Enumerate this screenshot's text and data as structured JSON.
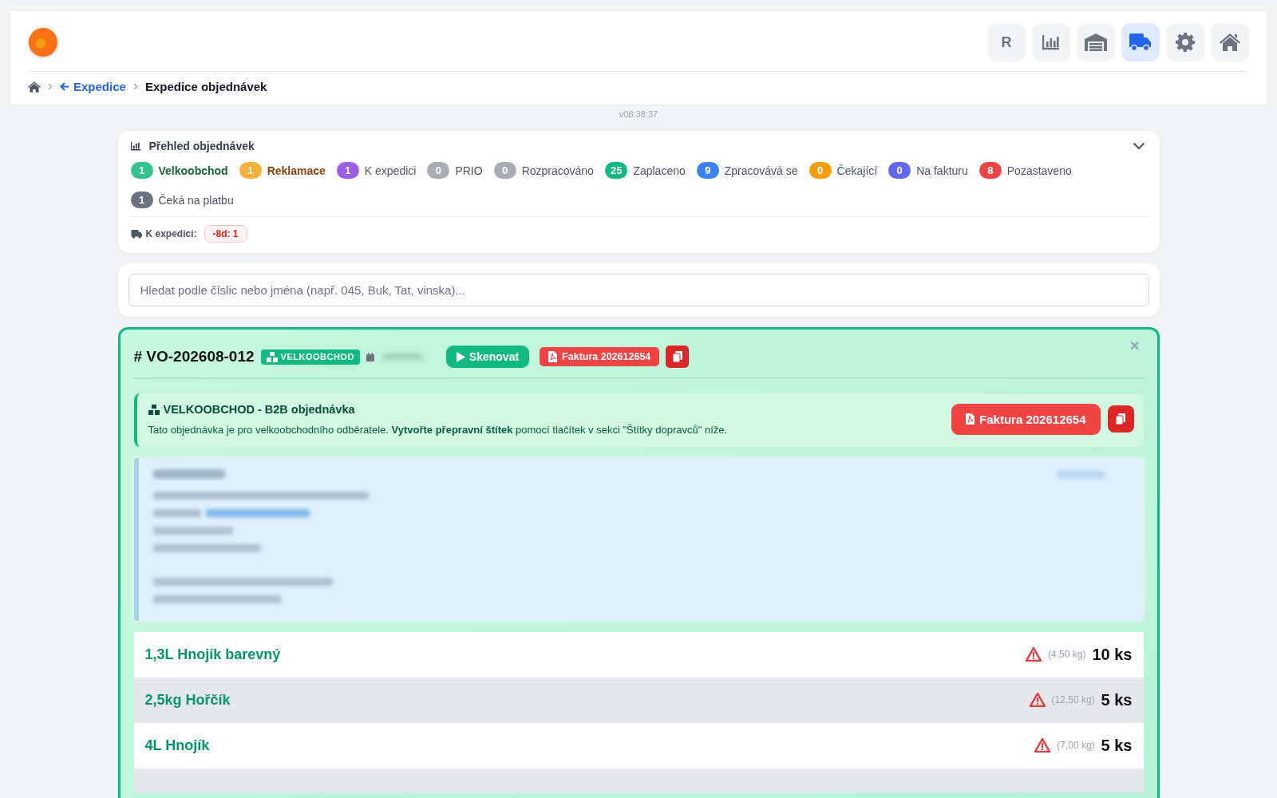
{
  "nav": [
    {
      "kind": "text",
      "label": "R",
      "selected": false
    },
    {
      "kind": "chart",
      "selected": false
    },
    {
      "kind": "warehouse",
      "selected": false
    },
    {
      "kind": "truck",
      "selected": true
    },
    {
      "kind": "gear",
      "selected": false
    },
    {
      "kind": "home",
      "selected": false
    }
  ],
  "breadcrumb": {
    "back": "Expedice",
    "current": "Expedice objednávek"
  },
  "version": "v08:38:37",
  "overview": {
    "title": "Přehled objednávek",
    "expanded": true,
    "statuses": [
      {
        "count": "1",
        "label": "Velkoobchod",
        "color": "#34c38f",
        "highlighted": true
      },
      {
        "count": "1",
        "label": "Reklamace",
        "color": "#f4b13a",
        "highlighted": true
      },
      {
        "count": "1",
        "label": "K expedici",
        "color": "#9b5de5",
        "highlighted": false
      },
      {
        "count": "0",
        "label": "PRIO",
        "color": "#a8adb5",
        "highlighted": false
      },
      {
        "count": "0",
        "label": "Rozpracováno",
        "color": "#a8adb5",
        "highlighted": false
      },
      {
        "count": "25",
        "label": "Zaplaceno",
        "color": "#10b981",
        "highlighted": false
      },
      {
        "count": "9",
        "label": "Zpracovává se",
        "color": "#3b82f6",
        "highlighted": false
      },
      {
        "count": "0",
        "label": "Čekající",
        "color": "#f59e0b",
        "highlighted": false
      },
      {
        "count": "0",
        "label": "Na fakturu",
        "color": "#6366f1",
        "highlighted": false
      },
      {
        "count": "8",
        "label": "Pozastaveno",
        "color": "#ef4444",
        "highlighted": false
      },
      {
        "count": "1",
        "label": "Čeká na platbu",
        "color": "#6b7280",
        "highlighted": false
      }
    ],
    "dispatch_label": "K expedici:",
    "dispatch_tag": "-8d: 1"
  },
  "search": {
    "placeholder": "Hledat podle číslic nebo jména (např. 045, Buk, Tat, vinska)..."
  },
  "order": {
    "number": "VO-202608-012",
    "hash": "#",
    "type_badge": "VELKOOBCHOD",
    "scan_button": "Skenovat",
    "invoice_button": "Faktura 202612654",
    "close": "×",
    "notice": {
      "title": "VELKOOBCHOD - B2B objednávka",
      "text": "Tato objednávka je pro velkoobchodního odběratele. **Vytvořte přepravní štítek** pomocí tlačítek v sekci \"Štítky dopravců\" níže.",
      "invoice_button": "Faktura 202612654"
    },
    "items": [
      {
        "name": "1,3L Hnojík barevný",
        "warning": true,
        "weight": "(4,50 kg)",
        "quantity": "10 ks"
      },
      {
        "name": "2,5kg Hořčík",
        "warning": true,
        "weight": "(12,50 kg)",
        "quantity": "5 ks"
      },
      {
        "name": "4L Hnojík",
        "warning": true,
        "weight": "(7,00 kg)",
        "quantity": "5 ks"
      }
    ]
  }
}
